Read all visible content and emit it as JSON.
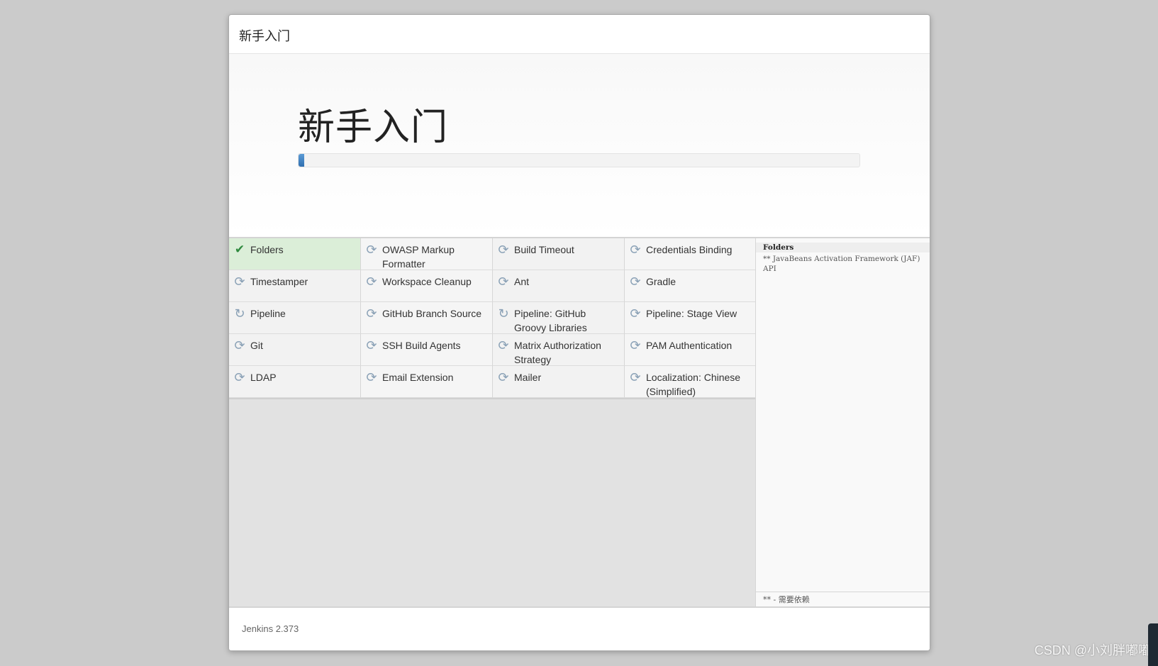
{
  "dialog": {
    "header_title": "新手入门",
    "hero_title": "新手入门",
    "progress_fraction": 0.01,
    "footer_version": "Jenkins 2.373"
  },
  "plugins": [
    {
      "name": "Folders",
      "status": "done",
      "icon": "check-icon"
    },
    {
      "name": "OWASP Markup Formatter",
      "status": "pending",
      "icon": "refresh-icon"
    },
    {
      "name": "Build Timeout",
      "status": "pending",
      "icon": "refresh-icon"
    },
    {
      "name": "Credentials Binding",
      "status": "pending",
      "icon": "refresh-icon"
    },
    {
      "name": "Timestamper",
      "status": "pending",
      "icon": "refresh-icon"
    },
    {
      "name": "Workspace Cleanup",
      "status": "pending",
      "icon": "refresh-icon"
    },
    {
      "name": "Ant",
      "status": "pending",
      "icon": "refresh-icon"
    },
    {
      "name": "Gradle",
      "status": "pending",
      "icon": "refresh-icon"
    },
    {
      "name": "Pipeline",
      "status": "installing",
      "icon": "spinner-icon"
    },
    {
      "name": "GitHub Branch Source",
      "status": "pending",
      "icon": "refresh-icon"
    },
    {
      "name": "Pipeline: GitHub Groovy Libraries",
      "status": "installing",
      "icon": "spinner-icon"
    },
    {
      "name": "Pipeline: Stage View",
      "status": "pending",
      "icon": "refresh-icon"
    },
    {
      "name": "Git",
      "status": "pending",
      "icon": "refresh-icon"
    },
    {
      "name": "SSH Build Agents",
      "status": "pending",
      "icon": "refresh-icon"
    },
    {
      "name": "Matrix Authorization Strategy",
      "status": "pending",
      "icon": "refresh-icon"
    },
    {
      "name": "PAM Authentication",
      "status": "pending",
      "icon": "refresh-icon"
    },
    {
      "name": "LDAP",
      "status": "pending",
      "icon": "refresh-icon"
    },
    {
      "name": "Email Extension",
      "status": "pending",
      "icon": "refresh-icon"
    },
    {
      "name": "Mailer",
      "status": "pending",
      "icon": "refresh-icon"
    },
    {
      "name": "Localization: Chinese (Simplified)",
      "status": "pending",
      "icon": "refresh-icon"
    }
  ],
  "log": {
    "title": "Folders",
    "line": "** JavaBeans Activation Framework (JAF) API",
    "legend": "** - 需要依赖"
  },
  "watermark": "CSDN @小刘胖嘟嘟",
  "colors": {
    "done_bg": "#dbeed8",
    "check": "#2f8a3f",
    "progress": "#3a7cc0",
    "refresh": "#8aa1b6"
  }
}
